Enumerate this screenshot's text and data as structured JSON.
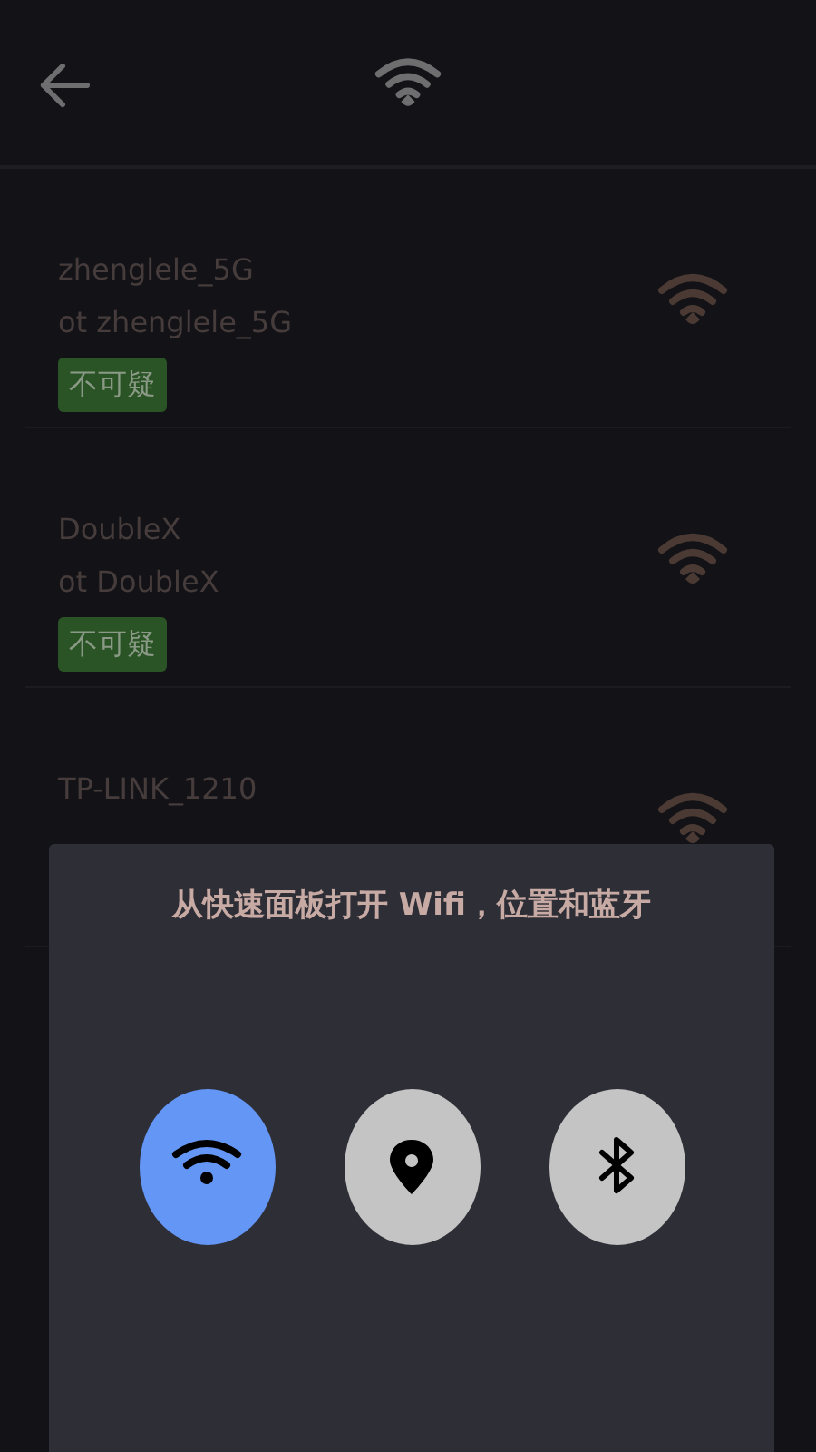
{
  "networks": [
    {
      "name": "zhenglele_5G",
      "subtitle": "ot zhenglele_5G",
      "badge": "不可疑"
    },
    {
      "name": "DoubleX",
      "subtitle": "ot DoubleX",
      "badge": "不可疑"
    },
    {
      "name": "TP-LINK_1210"
    }
  ],
  "quick_panel": {
    "title": "从快速面板打开 Wifi，位置和蓝牙",
    "toggles": [
      {
        "kind": "wifi",
        "on": true
      },
      {
        "kind": "location",
        "on": false
      },
      {
        "kind": "bluetooth",
        "on": false
      }
    ]
  }
}
